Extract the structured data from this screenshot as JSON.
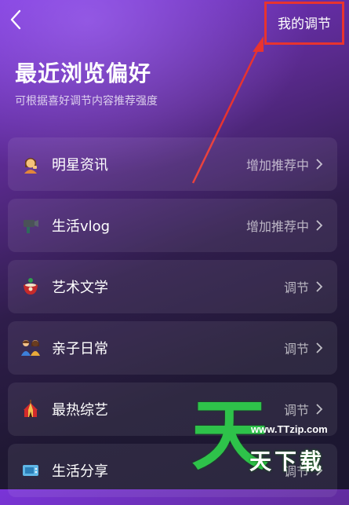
{
  "header": {
    "back_icon": "chevron-left-icon",
    "my_adjust_label": "我的调节",
    "highlight_color": "#e8332f"
  },
  "page": {
    "title": "最近浏览偏好",
    "subtitle": "可根据喜好调节内容推荐强度"
  },
  "items": [
    {
      "label": "明星资讯",
      "status": "增加推荐中",
      "icon": "celebrity-emoji-icon"
    },
    {
      "label": "生活vlog",
      "status": "增加推荐中",
      "icon": "vlog-camera-icon"
    },
    {
      "label": "艺术文学",
      "status": "调节",
      "icon": "art-pottery-icon"
    },
    {
      "label": "亲子日常",
      "status": "调节",
      "icon": "family-icon"
    },
    {
      "label": "最热综艺",
      "status": "调节",
      "icon": "circus-tent-icon"
    },
    {
      "label": "生活分享",
      "status": "调节",
      "icon": "tv-share-icon"
    }
  ],
  "watermark": {
    "big_char": "天",
    "url": "www.TTzip.com",
    "chars": "天下载"
  }
}
